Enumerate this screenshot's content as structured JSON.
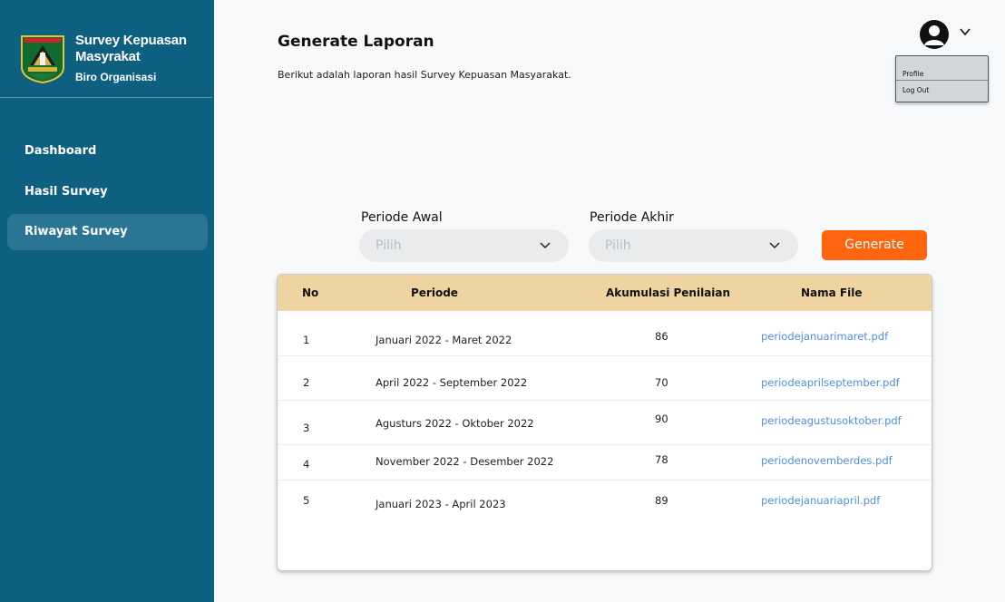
{
  "sidebar": {
    "title": "Survey Kepuasan Masyrakat",
    "subtitle": "Biro Organisasi",
    "nav": [
      {
        "label": "Dashboard"
      },
      {
        "label": "Hasil Survey"
      },
      {
        "label": "Riwayat Survey"
      }
    ]
  },
  "header": {
    "title": "Generate Laporan",
    "description": "Berikut adalah laporan hasil Survey Kepuasan Masyarakat."
  },
  "user_menu": {
    "items": [
      {
        "label": "Profile"
      },
      {
        "label": "Log Out"
      }
    ]
  },
  "filter": {
    "start_label": "Periode Awal",
    "start_value": "Pilih",
    "end_label": "Periode Akhir",
    "end_value": "Pilih",
    "button_label": "Generate"
  },
  "table": {
    "headers": [
      "No",
      "Periode",
      "Akumulasi Penilaian",
      "Nama File"
    ],
    "rows": [
      {
        "no": "1",
        "periode": "Januari  2022 - Maret 2022",
        "nilai": "86",
        "file": "periodejanuarimaret.pdf"
      },
      {
        "no": "2",
        "periode": "April 2022 - September 2022",
        "nilai": "70",
        "file": "periodeaprilseptember.pdf"
      },
      {
        "no": "3",
        "periode": "Agusturs 2022 - Oktober 2022",
        "nilai": "90",
        "file": "periodeagustusoktober.pdf"
      },
      {
        "no": "4",
        "periode": "November 2022 - Desember 2022",
        "nilai": "78",
        "file": "periodenovemberdes.pdf"
      },
      {
        "no": "5",
        "periode": "Januari 2023 - April 2023",
        "nilai": "89",
        "file": "periodejanuariapril.pdf"
      }
    ]
  },
  "colors": {
    "sidebar": "#0e6080",
    "active_nav": "#2a7593",
    "accent": "#ff650f",
    "table_header": "#efd3a0",
    "link": "#4f8fe6"
  },
  "icons": {
    "logo": "provincial-crest-logo",
    "avatar": "user-avatar-icon",
    "dropdown": "chevron-down-icon"
  }
}
